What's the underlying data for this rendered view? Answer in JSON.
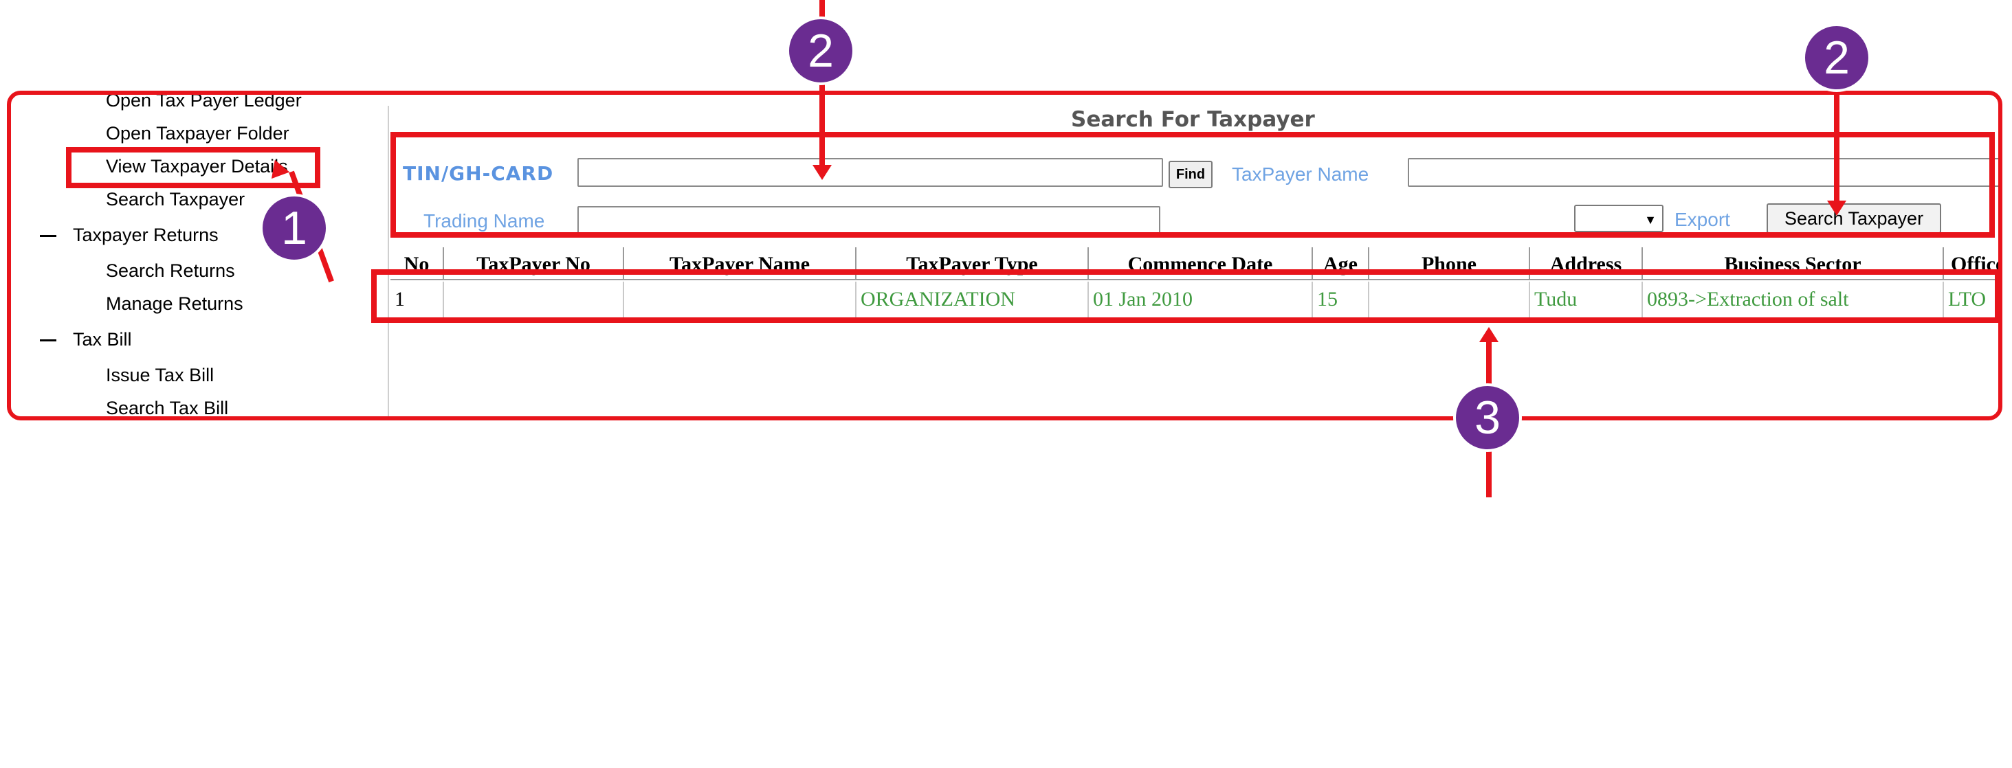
{
  "sidebar": {
    "items": [
      {
        "label": "Open Tax Payer Ledger"
      },
      {
        "label": "Open Taxpayer Folder"
      },
      {
        "label": "View Taxpayer Details"
      },
      {
        "label": "Search Taxpayer"
      }
    ],
    "groups": [
      {
        "label": "Taxpayer Returns",
        "items": [
          "Search Returns",
          "Manage Returns"
        ]
      },
      {
        "label": "Tax Bill",
        "items": [
          "Issue Tax Bill",
          "Search Tax Bill"
        ]
      }
    ]
  },
  "page": {
    "title": "Search For Taxpayer"
  },
  "search": {
    "tin_label": "TIN/GH-CARD",
    "tin_value": "",
    "find_label": "Find",
    "name_label": "TaxPayer Name",
    "name_value": "",
    "trading_label": "Trading Name",
    "trading_value": "",
    "select_value": "",
    "export_label": "Export",
    "search_button": "Search Taxpayer"
  },
  "table": {
    "headers": [
      "No",
      "TaxPayer No",
      "TaxPayer Name",
      "TaxPayer Type",
      "Commence Date",
      "Age",
      "Phone",
      "Address",
      "Business Sector",
      "Office"
    ],
    "rows": [
      {
        "no": "1",
        "taxpayer_no": "",
        "taxpayer_name": "",
        "type": "ORGANIZATION",
        "commence_date": "01 Jan 2010",
        "age": "15",
        "phone": "",
        "address": "Tudu",
        "business_sector": "0893->Extraction of salt",
        "office": "LTO"
      }
    ]
  },
  "annotations": {
    "badges": [
      "1",
      "2",
      "2",
      "3"
    ]
  },
  "colors": {
    "annotation_red": "#e8141b",
    "badge_purple": "#6a2c91",
    "label_blue": "#6fa3e3",
    "cell_green": "#3f9a3f"
  }
}
